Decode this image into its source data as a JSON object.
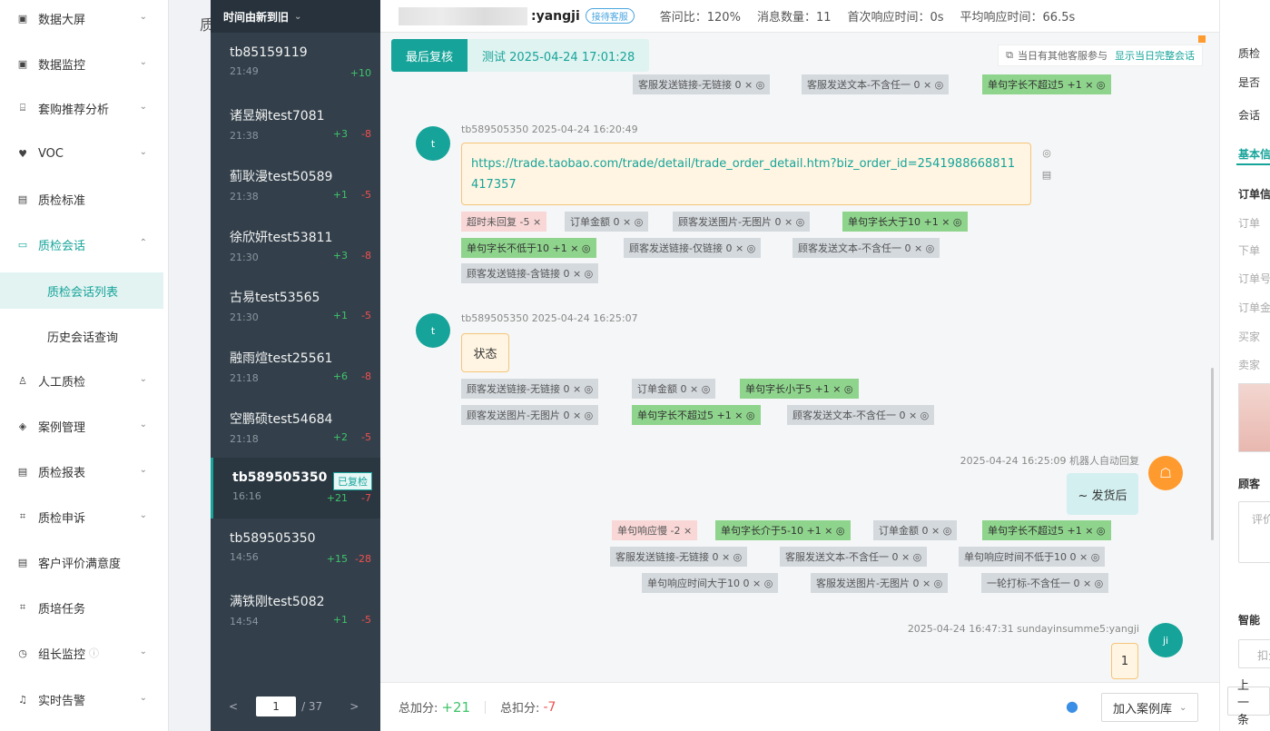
{
  "sidebar": {
    "items": [
      {
        "label": "数据大屏",
        "icon": "dashboard-icon",
        "chev": "⌄"
      },
      {
        "label": "数据监控",
        "icon": "monitor-icon",
        "chev": "⌄"
      },
      {
        "label": "套购推荐分析",
        "icon": "chart-icon",
        "chev": "⌄"
      },
      {
        "label": "VOC",
        "icon": "voc-icon",
        "chev": "⌄"
      },
      {
        "label": "质检标准",
        "icon": "document-icon",
        "chev": ""
      },
      {
        "label": "质检会话",
        "icon": "chat-icon",
        "chev": "⌃"
      },
      {
        "label": "人工质检",
        "icon": "user-icon",
        "chev": "⌄"
      },
      {
        "label": "案例管理",
        "icon": "case-icon",
        "chev": "⌄"
      },
      {
        "label": "质检报表",
        "icon": "report-icon",
        "chev": "⌄"
      },
      {
        "label": "质检申诉",
        "icon": "appeal-icon",
        "chev": "⌄"
      },
      {
        "label": "客户评价满意度",
        "icon": "rating-icon",
        "chev": ""
      },
      {
        "label": "质培任务",
        "icon": "task-icon",
        "chev": ""
      },
      {
        "label": "组长监控",
        "icon": "clock-icon",
        "chev": "⌄"
      },
      {
        "label": "实时告警",
        "icon": "bell-icon",
        "chev": "⌄"
      }
    ],
    "sub_items": [
      "质检会话列表",
      "历史会话查询"
    ]
  },
  "tabstrip": {
    "label": "质"
  },
  "sessions": {
    "header": "时间由新到旧",
    "list": [
      {
        "name": "tb85159119",
        "time": "21:49",
        "plus": "+10",
        "minus": ""
      },
      {
        "name": "诸昱娴test7081",
        "time": "21:38",
        "plus": "+3",
        "minus": "-8"
      },
      {
        "name": "蓟耿漫test50589",
        "time": "21:38",
        "plus": "+1",
        "minus": "-5"
      },
      {
        "name": "徐欣妍test53811",
        "time": "21:30",
        "plus": "+3",
        "minus": "-8"
      },
      {
        "name": "古易test53565",
        "time": "21:30",
        "plus": "+1",
        "minus": "-5"
      },
      {
        "name": "融雨煊test25561",
        "time": "21:18",
        "plus": "+6",
        "minus": "-8"
      },
      {
        "name": "空鹏硕test54684",
        "time": "21:18",
        "plus": "+2",
        "minus": "-5"
      },
      {
        "name": "tb589505350",
        "time": "16:16",
        "plus": "+21",
        "minus": "-7",
        "badge": "已复检"
      },
      {
        "name": "tb589505350",
        "time": "14:56",
        "plus": "+15",
        "minus": "-28"
      },
      {
        "name": "满铁刚test5082",
        "time": "14:54",
        "plus": "+1",
        "minus": "-5"
      }
    ],
    "pager": {
      "prev": "<",
      "page": "1",
      "total": "/ 37",
      "next": ">"
    }
  },
  "topbar": {
    "agent": ":yangji",
    "agent_tag": "接待客服",
    "stats": [
      "答问比：120%",
      "消息数量：11",
      "首次响应时间：0s",
      "平均响应时间：66.5s"
    ]
  },
  "review": {
    "label": "最后复核",
    "info": "测试  2025-04-24 17:01:28"
  },
  "notice": {
    "text": "当日有其他客服参与",
    "link": "显示当日完整会话"
  },
  "messages": {
    "m0_tags": [
      {
        "t": "客服发送链接-无链接 0 × ◎",
        "k": ""
      },
      {
        "t": "客服发送文本-不含任一 0 × ◎",
        "k": ""
      },
      {
        "t": "单句字长不超过5 +1 × ◎",
        "k": "g"
      }
    ],
    "m1": {
      "avatar": "t",
      "meta": "tb589505350  2025-04-24 16:20:49",
      "text": "https://trade.taobao.com/trade/detail/trade_order_detail.htm?biz_order_id=2541988668811417357",
      "tags": [
        {
          "t": "超时未回复 -5 ×",
          "k": "r"
        },
        {
          "t": "订单金额 0 × ◎",
          "k": ""
        },
        {
          "t": "顾客发送图片-无图片 0 × ◎",
          "k": ""
        },
        {
          "t": "单句字长大于10 +1 × ◎",
          "k": "g"
        },
        {
          "t": "单句字长不低于10 +1 × ◎",
          "k": "g"
        },
        {
          "t": "顾客发送链接-仅链接 0 × ◎",
          "k": ""
        },
        {
          "t": "顾客发送文本-不含任一 0 × ◎",
          "k": ""
        },
        {
          "t": "顾客发送链接-含链接 0 × ◎",
          "k": ""
        }
      ]
    },
    "m2": {
      "avatar": "t",
      "meta": "tb589505350  2025-04-24 16:25:07",
      "text": "状态",
      "tags": [
        {
          "t": "顾客发送链接-无链接 0 × ◎",
          "k": ""
        },
        {
          "t": "订单金额 0 × ◎",
          "k": ""
        },
        {
          "t": "单句字长小于5 +1 × ◎",
          "k": "g"
        },
        {
          "t": "顾客发送图片-无图片 0 × ◎",
          "k": ""
        },
        {
          "t": "单句字长不超过5 +1 × ◎",
          "k": "g"
        },
        {
          "t": "顾客发送文本-不含任一 0 × ◎",
          "k": ""
        }
      ]
    },
    "m3": {
      "meta": "2025-04-24 16:25:09  机器人自动回复",
      "text": "~ 发货后",
      "tags": [
        {
          "t": "单句响应慢 -2 ×",
          "k": "r"
        },
        {
          "t": "单句字长介于5-10 +1 × ◎",
          "k": "g"
        },
        {
          "t": "订单金额 0 × ◎",
          "k": ""
        },
        {
          "t": "单句字长不超过5 +1 × ◎",
          "k": "g"
        },
        {
          "t": "客服发送链接-无链接 0 × ◎",
          "k": ""
        },
        {
          "t": "客服发送文本-不含任一 0 × ◎",
          "k": ""
        },
        {
          "t": "单句响应时间不低于10 0 × ◎",
          "k": ""
        },
        {
          "t": "单句响应时间大于10 0 × ◎",
          "k": ""
        },
        {
          "t": "客服发送图片-无图片 0 × ◎",
          "k": ""
        },
        {
          "t": "一轮打标-不含任一 0 × ◎",
          "k": ""
        }
      ]
    },
    "m4": {
      "avatar": "ji",
      "meta": "2025-04-24 16:47:31  sundayinsumme5:yangji",
      "text": "1"
    }
  },
  "footer": {
    "plus_label": "总加分:",
    "plus": "+21",
    "minus_label": "总扣分:",
    "minus": "-7",
    "case_btn": "加入案例库",
    "prev_btn": "上一条"
  },
  "right": {
    "lines": [
      "质检",
      "是否",
      "会话",
      "基本信",
      "订单信",
      "订单",
      "下单",
      "订单号",
      "订单金",
      "买家",
      "卖家",
      "顾客",
      "评价",
      "智能",
      "扣分"
    ]
  },
  "colors": {
    "accent": "#16a49a",
    "plus": "#3fc46a",
    "minus": "#f05050",
    "sessions_bg": "#33404b"
  }
}
